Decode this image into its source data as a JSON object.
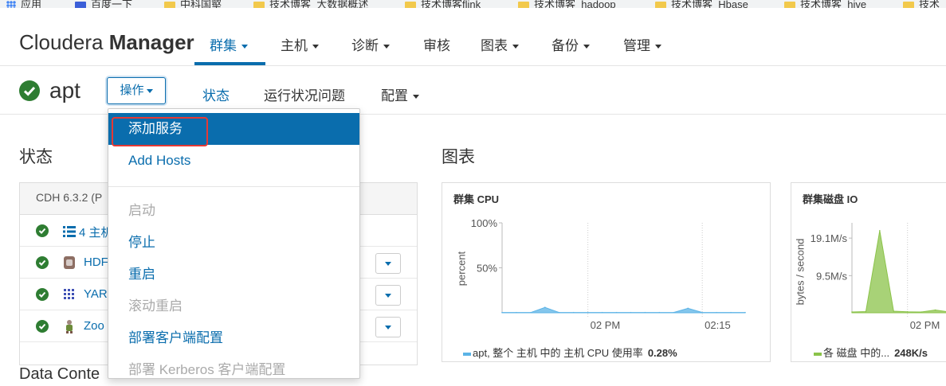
{
  "bookmarks": [
    {
      "label": "应用",
      "icon": "apps-grid-icon"
    },
    {
      "label": "百度一下",
      "icon": "baidu-icon"
    },
    {
      "label": "中科国壑",
      "icon": "folder-icon"
    },
    {
      "label": "技术博客_大数据概述",
      "icon": "folder-icon"
    },
    {
      "label": "技术博客flink",
      "icon": "folder-icon"
    },
    {
      "label": "技术博客_hadoop",
      "icon": "folder-icon"
    },
    {
      "label": "技术博客_Hbase",
      "icon": "folder-icon"
    },
    {
      "label": "技术博客_hive",
      "icon": "folder-icon"
    },
    {
      "label": "技术",
      "icon": "folder-icon"
    }
  ],
  "header": {
    "brand_light": "Cloudera ",
    "brand_bold": "Manager",
    "nav": [
      {
        "label": "群集",
        "dropdown": true,
        "active": true
      },
      {
        "label": "主机",
        "dropdown": true
      },
      {
        "label": "诊断",
        "dropdown": true
      },
      {
        "label": "审核",
        "dropdown": false
      },
      {
        "label": "图表",
        "dropdown": true
      },
      {
        "label": "备份",
        "dropdown": true
      },
      {
        "label": "管理",
        "dropdown": true
      }
    ]
  },
  "cluster": {
    "name": "apt",
    "ops_label": "操作",
    "tabs": [
      "状态",
      "运行状况问题",
      "配置"
    ]
  },
  "status": {
    "title": "状态",
    "version": "CDH 6.3.2 (P",
    "rows": [
      {
        "label": "4 主机",
        "icon": "list-icon"
      },
      {
        "label": "HDF",
        "icon": "hdfs-icon"
      },
      {
        "label": "YAR",
        "icon": "yarn-icon"
      },
      {
        "label": "Zoo",
        "icon": "zookeeper-icon"
      }
    ],
    "next_section_partial": "Data Conte"
  },
  "charts_section": {
    "title": "图表"
  },
  "menu": {
    "items": [
      {
        "label": "添加服务",
        "state": "highlighted"
      },
      {
        "label": "Add Hosts",
        "state": "enabled"
      },
      {
        "label": "启动",
        "state": "disabled"
      },
      {
        "label": "停止",
        "state": "enabled"
      },
      {
        "label": "重启",
        "state": "enabled"
      },
      {
        "label": "滚动重启",
        "state": "disabled"
      },
      {
        "label": "部署客户端配置",
        "state": "enabled"
      },
      {
        "label": "部署 Kerberos 客户端配置",
        "state": "disabled"
      }
    ]
  },
  "colors": {
    "accent": "#0a6dad",
    "ok_green": "#2e7d32",
    "cpu_series": "#5bb3e6",
    "disk_series": "#8bc34a",
    "annotation_red": "#e53935"
  },
  "chart_data": [
    {
      "type": "area",
      "title": "群集 CPU",
      "ylabel": "percent",
      "yticks": [
        "100%",
        "50%"
      ],
      "ylim": [
        0,
        100
      ],
      "xticks": [
        "02 PM",
        "02:15"
      ],
      "x": [
        "13:50",
        "13:52",
        "13:54",
        "13:56",
        "13:58",
        "14:00",
        "14:02",
        "14:04",
        "14:06",
        "14:08",
        "14:10",
        "14:12",
        "14:14",
        "14:16",
        "14:18",
        "14:20",
        "14:22",
        "14:24"
      ],
      "series": [
        {
          "name": "apt, 整个 主机 中的 主机 CPU 使用率",
          "values": [
            0.3,
            0.3,
            0.3,
            6,
            0.3,
            0.3,
            0.3,
            0.3,
            0.3,
            0.3,
            0.3,
            0.3,
            0.3,
            5,
            0.3,
            0.3,
            0.3,
            0.3
          ]
        }
      ],
      "legend_value": "0.28%"
    },
    {
      "type": "area",
      "title": "群集磁盘 IO",
      "ylabel": "bytes / second",
      "yticks": [
        "19.1M/s",
        "9.5M/s"
      ],
      "ylim": [
        0,
        23000000
      ],
      "xticks": [
        "02 PM"
      ],
      "x": [
        "13:54",
        "13:56",
        "13:58",
        "14:00",
        "14:02",
        "14:04",
        "14:06",
        "14:08"
      ],
      "series": [
        {
          "name": "各 磁盘 中的...",
          "values": [
            200000,
            300000,
            21000000,
            400000,
            250000,
            200000,
            700000,
            200000
          ]
        }
      ],
      "legend_value": "248K/s"
    }
  ]
}
